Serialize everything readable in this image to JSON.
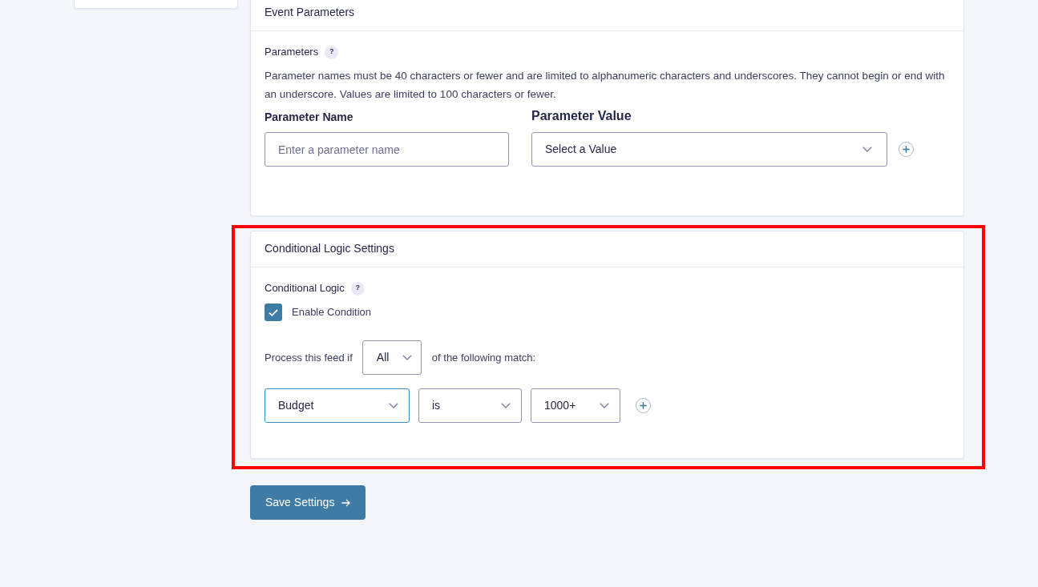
{
  "sections": [
    {
      "kind": "event_parameters",
      "title": "Event Parameters",
      "highlighted": false,
      "field_label": "Parameters",
      "help": "?",
      "description": "Parameter names must be 40 characters or fewer and are limited to alphanumeric characters and underscores. They cannot begin or end with an underscore. Values are limited to 100 characters or fewer.",
      "name_column": {
        "label": "Parameter Name",
        "placeholder": "Enter a parameter name"
      },
      "value_column": {
        "label": "Parameter Value",
        "value": "Select a Value"
      }
    },
    {
      "kind": "conditional_logic",
      "title": "Conditional Logic Settings",
      "highlighted": true,
      "field_label": "Conditional Logic",
      "help": "?",
      "checkbox": {
        "label": "Enable Condition",
        "checked": true
      },
      "match_sentence": {
        "before": "Process this feed if",
        "select": "All",
        "after": "of the following match:"
      },
      "rule": [
        {
          "value": "Budget",
          "focused": true
        },
        {
          "value": "is",
          "focused": false
        },
        {
          "value": "1000+",
          "focused": false
        }
      ]
    }
  ],
  "save_button": {
    "label": "Save Settings"
  }
}
